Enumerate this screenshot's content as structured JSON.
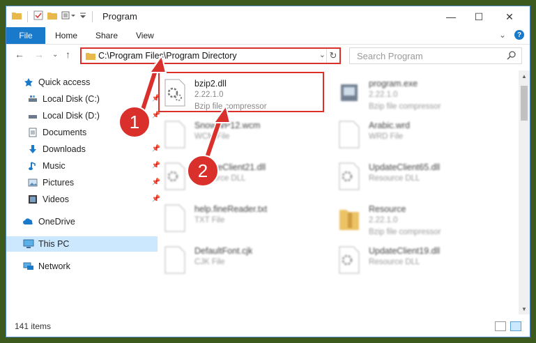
{
  "window": {
    "title": "Program",
    "controls": {
      "minimize": "—",
      "maximize": "☐",
      "close": "✕"
    }
  },
  "ribbon": {
    "file_tab": "File",
    "tabs": [
      "Home",
      "Share",
      "View"
    ]
  },
  "address": {
    "path": "C:\\Program Files\\Program Directory",
    "search_placeholder": "Search Program"
  },
  "sidebar": {
    "items": [
      {
        "label": "Quick access",
        "icon": "star-icon",
        "pinned": false
      },
      {
        "label": "Local Disk (C:)",
        "icon": "drive-icon",
        "pinned": true
      },
      {
        "label": "Local Disk (D:)",
        "icon": "drive-icon",
        "pinned": true
      },
      {
        "label": "Documents",
        "icon": "documents-icon",
        "pinned": false
      },
      {
        "label": "Downloads",
        "icon": "download-icon",
        "pinned": true
      },
      {
        "label": "Music",
        "icon": "music-icon",
        "pinned": true
      },
      {
        "label": "Pictures",
        "icon": "pictures-icon",
        "pinned": true
      },
      {
        "label": "Videos",
        "icon": "videos-icon",
        "pinned": true
      },
      {
        "label": "OneDrive",
        "icon": "cloud-icon",
        "pinned": false
      },
      {
        "label": "This PC",
        "icon": "computer-icon",
        "pinned": false,
        "selected": true
      },
      {
        "label": "Network",
        "icon": "network-icon",
        "pinned": false
      }
    ]
  },
  "files": [
    {
      "name": "bzip2.dll",
      "line1": "2.22.1.0",
      "line2": "Bzip file compressor",
      "icon": "dll-file-icon",
      "highlighted": true
    },
    {
      "name": "program.exe",
      "line1": "2.22.1.0",
      "line2": "Bzip file compressor",
      "icon": "exe-file-icon"
    },
    {
      "name": "SnowWP12.wcm",
      "line1": "WCM File",
      "line2": "",
      "icon": "blank-file-icon"
    },
    {
      "name": "Arabic.wrd",
      "line1": "WRD File",
      "line2": "",
      "icon": "blank-file-icon"
    },
    {
      "name": "UpdateClient21.dll",
      "line1": "Resource DLL",
      "line2": "",
      "icon": "dll-file-icon"
    },
    {
      "name": "UpdateClient65.dll",
      "line1": "Resource DLL",
      "line2": "",
      "icon": "dll-file-icon"
    },
    {
      "name": "help.fineReader.txt",
      "line1": "TXT File",
      "line2": "",
      "icon": "blank-file-icon"
    },
    {
      "name": "Resource",
      "line1": "2.22.1.0",
      "line2": "Bzip file compressor",
      "icon": "folder-icon"
    },
    {
      "name": "DefaultFont.cjk",
      "line1": "CJK File",
      "line2": "",
      "icon": "blank-file-icon"
    },
    {
      "name": "UpdateClient19.dll",
      "line1": "Resource DLL",
      "line2": "",
      "icon": "dll-file-icon"
    }
  ],
  "status": {
    "item_count": "141 items"
  },
  "annotations": {
    "step1": "1",
    "step2": "2"
  },
  "colors": {
    "accent": "#1979ca",
    "highlight": "#d9302c",
    "selected": "#cce8ff"
  }
}
